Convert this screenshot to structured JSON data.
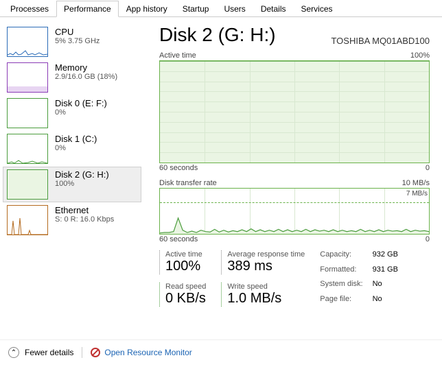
{
  "tabs": {
    "processes": "Processes",
    "performance": "Performance",
    "appHistory": "App history",
    "startup": "Startup",
    "users": "Users",
    "details": "Details",
    "services": "Services"
  },
  "sidebar": {
    "cpu": {
      "label": "CPU",
      "sub": "5% 3.75 GHz"
    },
    "memory": {
      "label": "Memory",
      "sub": "2.9/16.0 GB (18%)"
    },
    "disk0": {
      "label": "Disk 0 (E: F:)",
      "sub": "0%"
    },
    "disk1": {
      "label": "Disk 1 (C:)",
      "sub": "0%"
    },
    "disk2": {
      "label": "Disk 2 (G: H:)",
      "sub": "100%"
    },
    "ethernet": {
      "label": "Ethernet",
      "sub": "S: 0 R: 16.0 Kbps"
    }
  },
  "main": {
    "title": "Disk 2 (G: H:)",
    "model": "TOSHIBA MQ01ABD100",
    "activeTimeLabel": "Active time",
    "activeTimeMax": "100%",
    "timeAxis": "60 seconds",
    "zero": "0",
    "transferLabel": "Disk transfer rate",
    "transferMax": "10 MB/s",
    "transferInner": "7 MB/s"
  },
  "stats": {
    "activeTime": {
      "label": "Active time",
      "value": "100%"
    },
    "avgResponse": {
      "label": "Average response time",
      "value": "389 ms"
    },
    "readSpeed": {
      "label": "Read speed",
      "value": "0 KB/s"
    },
    "writeSpeed": {
      "label": "Write speed",
      "value": "1.0 MB/s"
    },
    "capacity": {
      "k": "Capacity:",
      "v": "932 GB"
    },
    "formatted": {
      "k": "Formatted:",
      "v": "931 GB"
    },
    "systemDisk": {
      "k": "System disk:",
      "v": "No"
    },
    "pageFile": {
      "k": "Page file:",
      "v": "No"
    }
  },
  "footer": {
    "fewer": "Fewer details",
    "resmon": "Open Resource Monitor"
  },
  "chart_data": [
    {
      "type": "line",
      "title": "Active time",
      "ylabel": "%",
      "ylim": [
        0,
        100
      ],
      "xlabel": "seconds",
      "xlim": [
        60,
        0
      ],
      "values": [
        100,
        100,
        100,
        100,
        100,
        100,
        100,
        100,
        100,
        100,
        100,
        100,
        100,
        100,
        100,
        100,
        100,
        100,
        100,
        100,
        100,
        100,
        100,
        100,
        100,
        100,
        100,
        100,
        100,
        100,
        100,
        100,
        100,
        100,
        100,
        100,
        100,
        100,
        100,
        100,
        100,
        100,
        100,
        100,
        100,
        100,
        100,
        100,
        100,
        100,
        100,
        100,
        100,
        100,
        100,
        100,
        100,
        100,
        100,
        100
      ]
    },
    {
      "type": "line",
      "title": "Disk transfer rate",
      "ylabel": "MB/s",
      "ylim": [
        0,
        10
      ],
      "xlabel": "seconds",
      "xlim": [
        60,
        0
      ],
      "dashed_threshold": 7,
      "values": [
        0.2,
        0.3,
        0.3,
        0.5,
        3.5,
        0.8,
        0.3,
        0.6,
        0.3,
        0.8,
        0.5,
        0.4,
        1.0,
        0.4,
        0.8,
        0.4,
        0.7,
        0.5,
        0.9,
        0.5,
        1.1,
        0.5,
        0.9,
        0.5,
        0.8,
        0.5,
        1.0,
        0.5,
        0.9,
        0.5,
        0.8,
        0.5,
        1.0,
        0.5,
        0.9,
        0.6,
        0.8,
        0.5,
        0.9,
        0.5,
        0.8,
        0.5,
        0.7,
        0.5,
        1.0,
        0.5,
        0.8,
        0.5,
        0.9,
        0.5,
        0.8,
        0.6,
        0.7,
        0.5,
        1.0,
        0.5,
        0.8,
        0.6,
        0.7,
        0.5
      ]
    }
  ]
}
